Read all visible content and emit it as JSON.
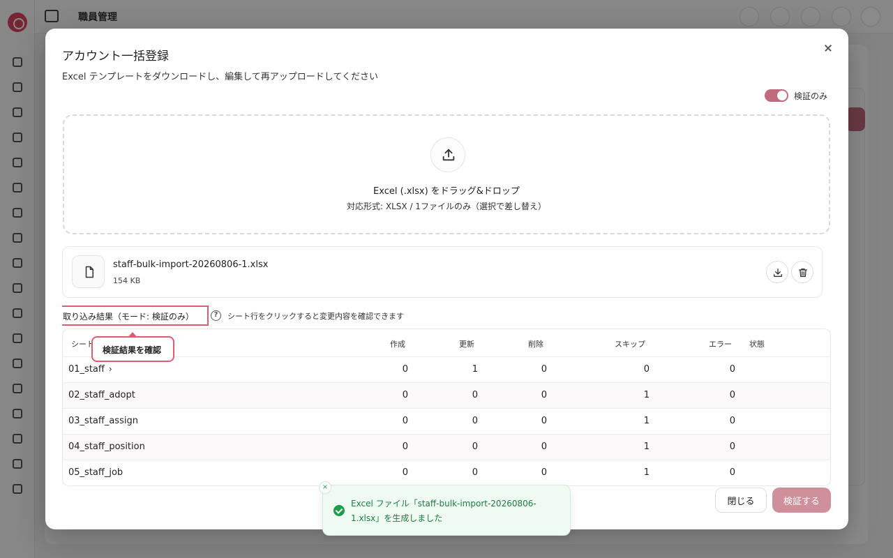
{
  "app": {
    "page_title": "職員管理"
  },
  "modal": {
    "title": "アカウント一括登録",
    "subtitle": "Excel テンプレートをダウンロードし、編集して再アップロードしてください",
    "verify_only_label": "検証のみ",
    "verify_only_on": true
  },
  "dropzone": {
    "main_text": "Excel (.xlsx) をドラッグ&ドロップ",
    "sub_text": "対応形式: XLSX / 1ファイルのみ（選択で差し替え）"
  },
  "file": {
    "name": "staff-bulk-import-20260806-1.xlsx",
    "size": "154 KB"
  },
  "results": {
    "title": "取り込み結果（モード: 検証のみ）",
    "help_text": "シート行をクリックすると変更内容を確認できます",
    "tooltip": "検証結果を確認",
    "columns": {
      "sheet": "シート",
      "create": "作成",
      "update": "更新",
      "delete": "削除",
      "skip": "スキップ",
      "error": "エラー",
      "status": "状態"
    },
    "rows": [
      {
        "sheet": "01_staff",
        "create": "0",
        "update": "1",
        "delete": "0",
        "skip": "0",
        "error": "0",
        "status": ""
      },
      {
        "sheet": "02_staff_adopt",
        "create": "0",
        "update": "0",
        "delete": "0",
        "skip": "1",
        "error": "0",
        "status": ""
      },
      {
        "sheet": "03_staff_assign",
        "create": "0",
        "update": "0",
        "delete": "0",
        "skip": "1",
        "error": "0",
        "status": ""
      },
      {
        "sheet": "04_staff_position",
        "create": "0",
        "update": "0",
        "delete": "0",
        "skip": "1",
        "error": "0",
        "status": ""
      },
      {
        "sheet": "05_staff_job",
        "create": "0",
        "update": "0",
        "delete": "0",
        "skip": "1",
        "error": "0",
        "status": ""
      }
    ]
  },
  "buttons": {
    "close": "閉じる",
    "verify": "検証する"
  },
  "toast": {
    "message": "Excel ファイル「staff-bulk-import-20260806-1.xlsx」を生成しました",
    "close_symbol": "×"
  },
  "colors": {
    "accent": "#c06b7d",
    "highlight": "#e15a6e",
    "success": "#1f9d4d"
  }
}
